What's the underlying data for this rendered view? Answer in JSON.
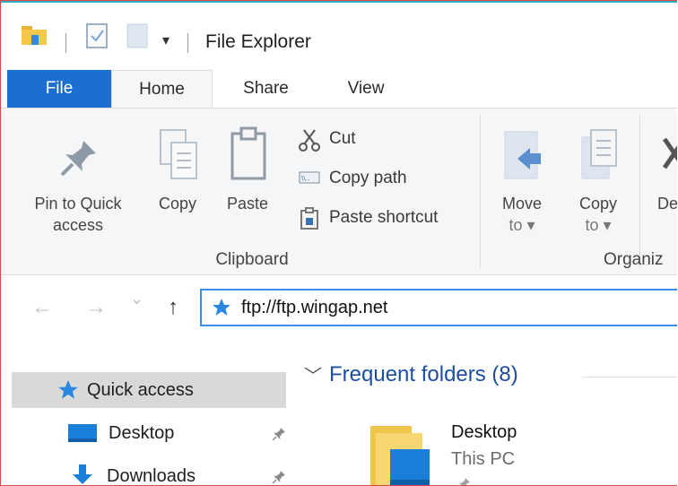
{
  "window": {
    "title": "File Explorer"
  },
  "quick_access_toolbar": {
    "icons": [
      "folder-icon",
      "properties-icon",
      "new-folder-icon",
      "customize-dropdown-icon"
    ]
  },
  "tabs": [
    {
      "label": "File",
      "active": false
    },
    {
      "label": "Home",
      "active": true
    },
    {
      "label": "Share",
      "active": false
    },
    {
      "label": "View",
      "active": false
    }
  ],
  "ribbon": {
    "clipboard": {
      "label": "Clipboard",
      "pin_line1": "Pin to Quick",
      "pin_line2": "access",
      "copy": "Copy",
      "paste": "Paste",
      "cut": "Cut",
      "copy_path": "Copy path",
      "paste_shortcut": "Paste shortcut"
    },
    "organize": {
      "label": "Organiz",
      "move_line1": "Move",
      "move_line2": "to ▾",
      "copy_line1": "Copy",
      "copy_line2": "to ▾",
      "delete_partial": "De"
    }
  },
  "address_bar": {
    "back": "←",
    "forward": "→",
    "recent": "⌄",
    "up": "↑",
    "path": "ftp://ftp.wingap.net"
  },
  "nav_pane": {
    "items": [
      {
        "label": "Quick access",
        "selected": true
      },
      {
        "label": "Desktop",
        "pinned": true
      },
      {
        "label": "Downloads",
        "pinned": true
      }
    ]
  },
  "content": {
    "section_title": "Frequent folders (8)",
    "folders": [
      {
        "name": "Desktop",
        "location": "This PC"
      }
    ]
  },
  "colors": {
    "file_tab": "#1a6fd0",
    "address_border": "#3c8ee8",
    "section_title": "#1d4fa1",
    "window_border": "#e04848",
    "title_accent": "#2ab0c0"
  }
}
